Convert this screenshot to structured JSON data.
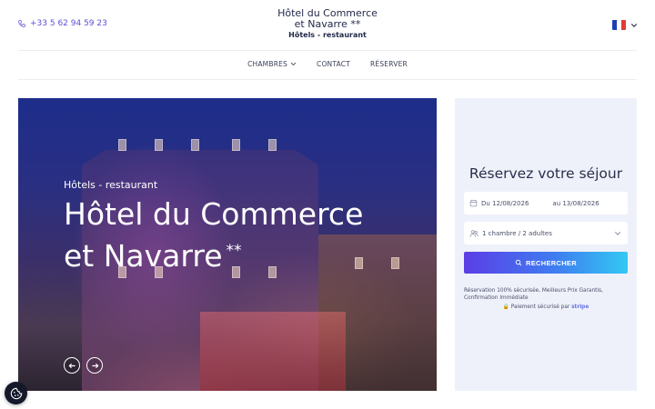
{
  "header": {
    "phone": "+33 5 62 94 59 23",
    "hotel_name_line1": "Hôtel du Commerce",
    "hotel_name_line2": "et Navarre  **",
    "hotel_type": "Hôtels - restaurant",
    "language_flag": "france-flag",
    "flag_colors": [
      "#1f3fb5",
      "#ffffff",
      "#e53935"
    ]
  },
  "nav": {
    "items": [
      {
        "label": "CHAMBRES",
        "has_dropdown": true
      },
      {
        "label": "CONTACT"
      },
      {
        "label": "RÉSERVER"
      }
    ]
  },
  "hero": {
    "tagline": "Hôtels - restaurant",
    "title_line1": "Hôtel du Commerce",
    "title_line2": "et Navarre",
    "stars": "**",
    "prev_icon": "arrow-left-icon",
    "next_icon": "arrow-right-icon"
  },
  "booking": {
    "heading": "Réservez votre séjour",
    "date_from": "Du 12/08/2026",
    "date_to": "au 13/08/2026",
    "guests": "1 chambre / 2 adultes",
    "search_label": "RECHERCHER",
    "note": "Réservation 100% sécurisée, Meilleurs Prix Garantis, Confirmation Immédiate",
    "secure_text": "Paiement sécurisé par",
    "secure_brand": "stripe",
    "accent_gradient": [
      "#5b3ee6",
      "#3f7cf0",
      "#33c8f2"
    ]
  },
  "cookie": {
    "icon": "cookie-settings-icon"
  }
}
